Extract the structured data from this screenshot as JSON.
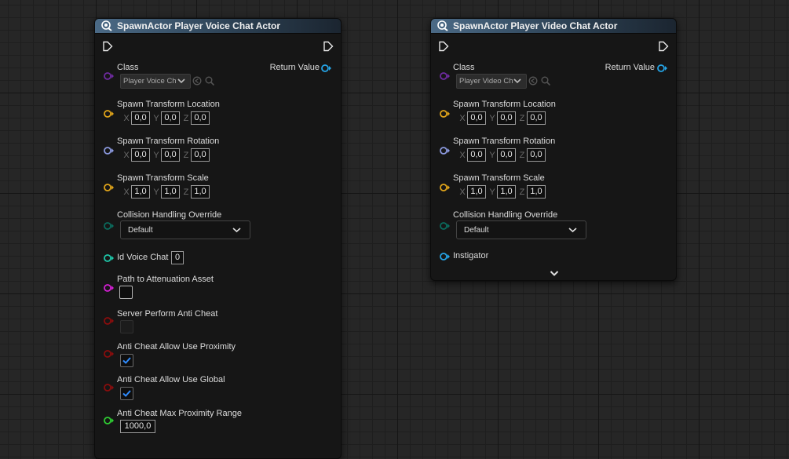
{
  "nodes": [
    {
      "title": "SpawnActor Player Voice Chat Actor",
      "class_label": "Class",
      "class_value": "Player Voice Chat Actor",
      "return_label": "Return Value",
      "location": {
        "label": "Spawn Transform Location",
        "x": "0,0",
        "y": "0,0",
        "z": "0,0"
      },
      "rotation": {
        "label": "Spawn Transform Rotation",
        "x": "0,0",
        "y": "0,0",
        "z": "0,0"
      },
      "scale": {
        "label": "Spawn Transform Scale",
        "x": "1,0",
        "y": "1,0",
        "z": "1,0"
      },
      "collision": {
        "label": "Collision Handling Override",
        "value": "Default"
      },
      "id_voice_chat": {
        "label": "Id Voice Chat",
        "value": "0"
      },
      "path_attenuation": {
        "label": "Path to Attenuation Asset"
      },
      "server_anti_cheat": {
        "label": "Server Perform Anti Cheat"
      },
      "allow_proximity": {
        "label": "Anti Cheat Allow Use Proximity",
        "checked": true
      },
      "allow_global": {
        "label": "Anti Cheat Allow Use Global",
        "checked": true
      },
      "max_range": {
        "label": "Anti Cheat Max Proximity Range",
        "value": "1000,0"
      }
    },
    {
      "title": "SpawnActor Player Video Chat Actor",
      "class_label": "Class",
      "class_value": "Player Video Chat Actor",
      "return_label": "Return Value",
      "location": {
        "label": "Spawn Transform Location",
        "x": "0,0",
        "y": "0,0",
        "z": "0,0"
      },
      "rotation": {
        "label": "Spawn Transform Rotation",
        "x": "0,0",
        "y": "0,0",
        "z": "0,0"
      },
      "scale": {
        "label": "Spawn Transform Scale",
        "x": "1,0",
        "y": "1,0",
        "z": "1,0"
      },
      "collision": {
        "label": "Collision Handling Override",
        "value": "Default"
      },
      "instigator": {
        "label": "Instigator"
      }
    }
  ],
  "axis_labels": {
    "x": "X",
    "y": "Y",
    "z": "Z"
  },
  "colors": {
    "class_pin": "#6f2ba0",
    "vector_pin": "#e0a41a",
    "rotator_pin": "#8c9adf",
    "enum_pin": "#0b6b5d",
    "int_pin": "#1ec7a9",
    "softref_pin": "#d31fd3",
    "bool_pin": "#8a0d0d",
    "float_pin": "#2fcf33",
    "object_pin": "#25a4e6",
    "header": "#4b6a86"
  },
  "icons": [
    "spawn-actor-icon",
    "exec-in-icon",
    "exec-out-icon",
    "browse-icon",
    "search-icon",
    "chevron-down-icon",
    "checkmark-icon",
    "advanced-expand-icon"
  ]
}
